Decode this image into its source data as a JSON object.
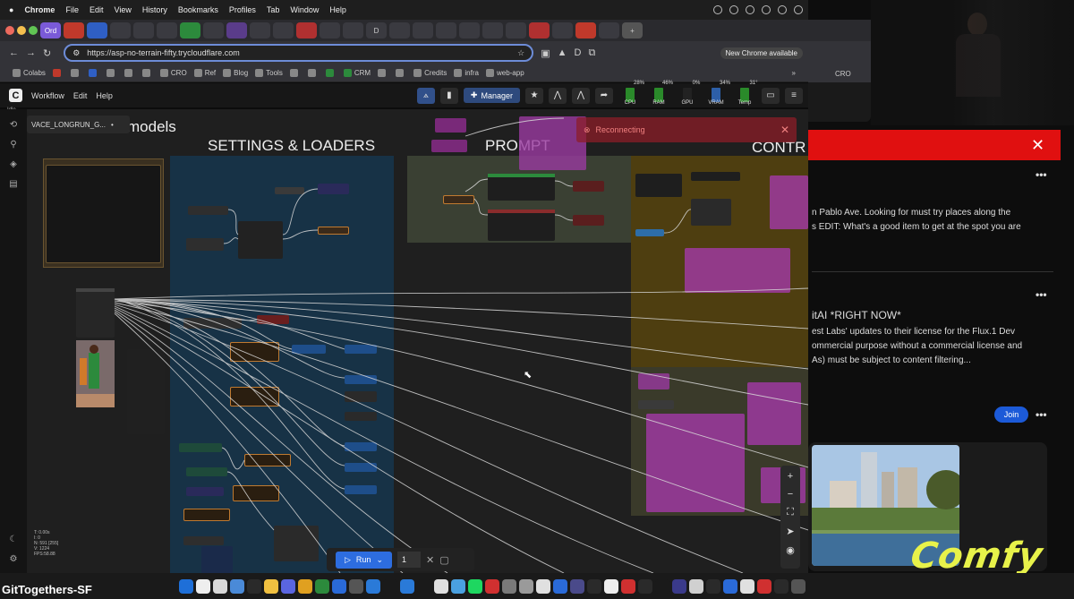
{
  "menubar": {
    "app": "Chrome",
    "items": [
      "File",
      "Edit",
      "View",
      "History",
      "Bookmarks",
      "Profiles",
      "Tab",
      "Window",
      "Help"
    ]
  },
  "tabs": [
    "Ord",
    "",
    "",
    "",
    "",
    "",
    "",
    "",
    "",
    "",
    "",
    "",
    "",
    "",
    "",
    "",
    "D",
    "",
    "",
    "",
    "",
    "",
    "",
    "",
    "",
    ""
  ],
  "address": {
    "url": "https://asp-no-terrain-fifty.trycloudflare.com",
    "new_chrome": "New Chrome available"
  },
  "bookmarks": [
    "Colabs",
    "",
    "",
    "",
    "",
    "",
    "",
    "CRO",
    "Ref",
    "Blog",
    "Tools",
    "",
    "",
    "",
    "CRM",
    "",
    "",
    "Credits",
    "infra",
    "web-app"
  ],
  "comfy": {
    "logo": "C",
    "menus": [
      "Workflow",
      "Edit",
      "Help"
    ],
    "status": "Idle",
    "manager": "Manager",
    "stats": [
      {
        "label": "CPU",
        "value": "28%"
      },
      {
        "label": "RAM",
        "value": "46%"
      },
      {
        "label": "GPU",
        "value": "0%"
      },
      {
        "label": "VRAM",
        "value": "34%"
      },
      {
        "label": "Temp",
        "value": "31°"
      }
    ]
  },
  "workflow_tab": {
    "label": "VACE_LONGRUN_G...",
    "dot": "•"
  },
  "canvas": {
    "groups": [
      {
        "title": "models"
      },
      {
        "title": "SETTINGS & LOADERS"
      },
      {
        "title": "PROMPT"
      },
      {
        "title": "CONTR"
      }
    ]
  },
  "reconnecting": {
    "text": "Reconnecting"
  },
  "run": {
    "label": "Run",
    "batch": "1"
  },
  "canvas_stats": [
    "T: 0.00s",
    "I: 0",
    "N: 591 [255]",
    "V: 1224",
    "FPS:58.88"
  ],
  "right_panel": {
    "post1": [
      "n Pablo Ave. Looking for must try places along the",
      "s EDIT: What's a good item to get at the spot you are"
    ],
    "post2_title": "itAI *RIGHT NOW*",
    "post2": [
      "est Labs' updates to their license for the Flux.1 Dev",
      "ommercial purpose without a commercial license and",
      "As) must be subject to content filtering..."
    ],
    "join": "Join",
    "bookmark_cro": "CRO",
    "logo_text": "Comfy"
  },
  "overlay_name": "GitTogethers-SF"
}
